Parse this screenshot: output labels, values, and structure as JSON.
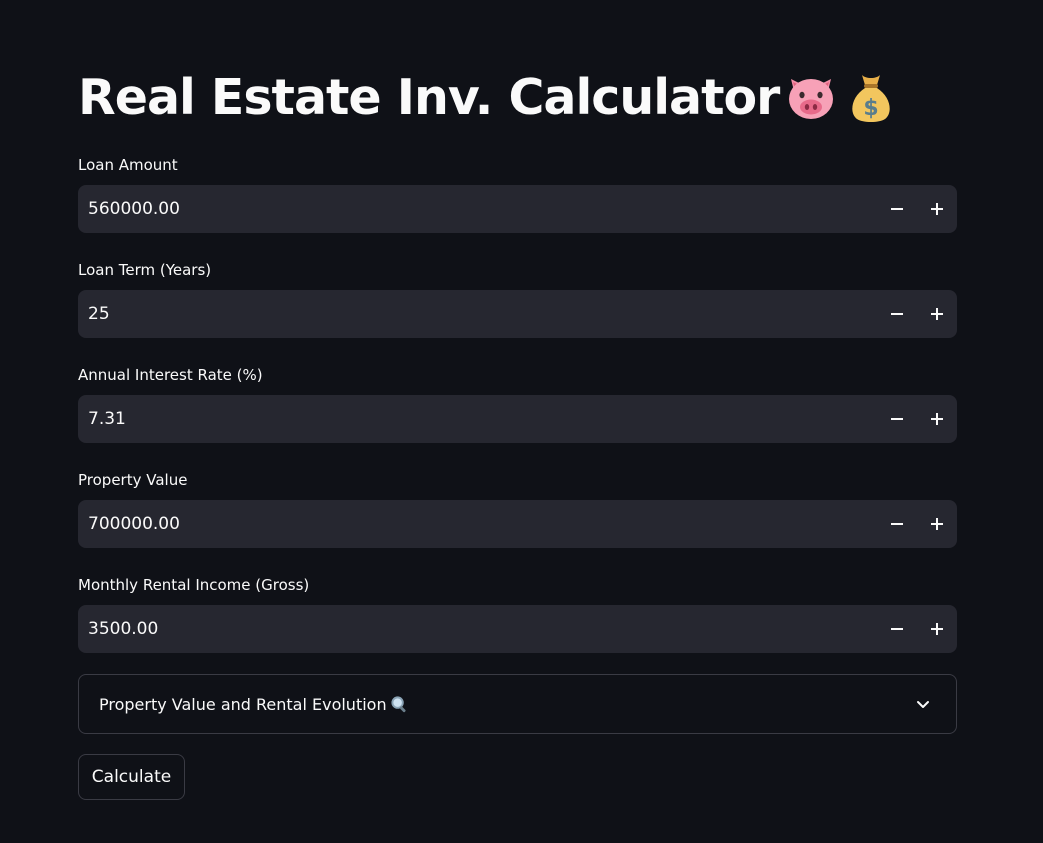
{
  "app": {
    "title": "Real Estate Inv. Calculator",
    "title_emojis": [
      "pig-face-icon",
      "money-bag-icon"
    ]
  },
  "fields": [
    {
      "label": "Loan Amount",
      "value": "560000.00"
    },
    {
      "label": "Loan Term (Years)",
      "value": "25"
    },
    {
      "label": "Annual Interest Rate (%)",
      "value": "7.31"
    },
    {
      "label": "Property Value",
      "value": "700000.00"
    },
    {
      "label": "Monthly Rental Income (Gross)",
      "value": "3500.00"
    }
  ],
  "expander": {
    "label": "Property Value and Rental Evolution",
    "icon": "magnifying-glass-icon",
    "state": "collapsed"
  },
  "actions": {
    "calculate_label": "Calculate"
  },
  "colors": {
    "background": "#0f1117",
    "input_background": "#262730",
    "border": "#3a3b44",
    "text": "#fafafa"
  }
}
